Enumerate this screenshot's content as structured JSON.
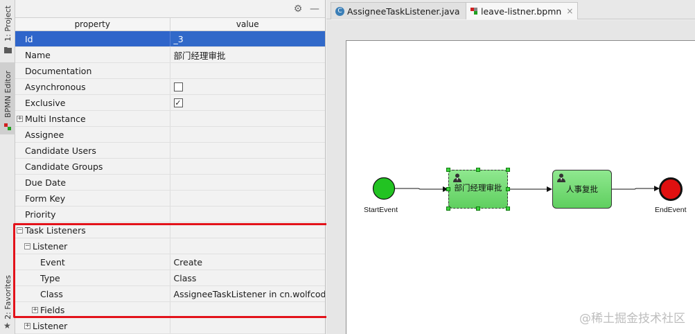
{
  "side_tabs": {
    "project": "1: Project",
    "bpmn_editor": "BPMN Editor",
    "favorites": "2: Favorites"
  },
  "properties": {
    "header": {
      "property": "property",
      "value": "value"
    },
    "rows": [
      {
        "label": "Id",
        "value": "_3"
      },
      {
        "label": "Name",
        "value": "部门经理审批"
      },
      {
        "label": "Documentation",
        "value": ""
      },
      {
        "label": "Asynchronous",
        "value": ""
      },
      {
        "label": "Exclusive",
        "value": "✓"
      },
      {
        "label": "Multi Instance",
        "value": ""
      },
      {
        "label": "Assignee",
        "value": ""
      },
      {
        "label": "Candidate Users",
        "value": ""
      },
      {
        "label": "Candidate Groups",
        "value": ""
      },
      {
        "label": "Due Date",
        "value": ""
      },
      {
        "label": "Form Key",
        "value": ""
      },
      {
        "label": "Priority",
        "value": ""
      },
      {
        "label": "Task Listeners",
        "value": ""
      },
      {
        "label": "Listener",
        "value": ""
      },
      {
        "label": "Event",
        "value": "Create"
      },
      {
        "label": "Type",
        "value": "Class"
      },
      {
        "label": "Class",
        "value": "AssigneeTaskListener in cn.wolfcode"
      },
      {
        "label": "Fields",
        "value": ""
      },
      {
        "label": "Listener",
        "value": ""
      }
    ]
  },
  "tabs": [
    {
      "label": "AssigneeTaskListener.java",
      "close": "×"
    },
    {
      "label": "leave-listner.bpmn",
      "close": "×"
    }
  ],
  "diagram": {
    "start_label": "StartEvent",
    "task1_label": "部门经理审批",
    "task2_label": "人事复批",
    "end_label": "EndEvent"
  },
  "watermark": "@稀土掘金技术社区",
  "colors": {
    "selection": "#2f65ca",
    "highlight_box": "#e3121a",
    "task_fill": "#6fd96f",
    "start_event": "#22c322",
    "end_event": "#e01010"
  }
}
